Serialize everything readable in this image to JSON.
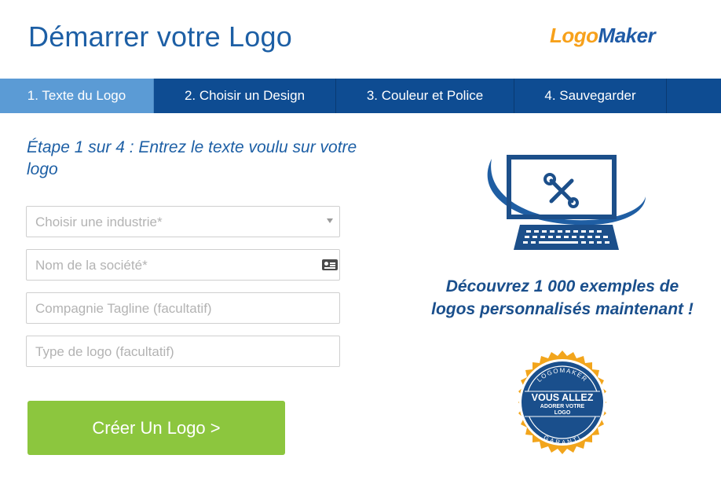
{
  "header": {
    "title": "Démarrer votre Logo",
    "brand_part1": "Logo",
    "brand_part2": "Maker"
  },
  "steps": [
    {
      "label": "1. Texte du Logo",
      "active": true
    },
    {
      "label": "2. Choisir un Design",
      "active": false
    },
    {
      "label": "3. Couleur et Police",
      "active": false
    },
    {
      "label": "4. Sauvegarder",
      "active": false
    }
  ],
  "form": {
    "instruction": "Étape 1 sur 4 : Entrez le texte voulu sur votre logo",
    "industry_placeholder": "Choisir une industrie*",
    "company_placeholder": "Nom de la société*",
    "tagline_placeholder": "Compagnie Tagline (facultatif)",
    "logo_type_placeholder": "Type de logo (facultatif)",
    "submit_label": "Créer Un Logo >"
  },
  "promo": {
    "text": "Découvrez 1 000 exemples de logos personnalisés maintenant !",
    "seal_top": "LOGOMAKER",
    "seal_main": "VOUS ALLEZ",
    "seal_line2": "ADORER VOTRE",
    "seal_line3": "LOGO",
    "seal_bottom": "GARANTI"
  },
  "colors": {
    "title_blue": "#1d5fa5",
    "nav_blue": "#0e4c92",
    "active_step": "#5b9bd5",
    "cta_green": "#8cc63e",
    "brand_orange": "#f7a11b",
    "seal_gold": "#f2a51c"
  },
  "icons": {
    "industry_dropdown": "chevron-down-icon",
    "company_field": "contact-card-icon",
    "illustration": "computer-tools-icon",
    "seal": "guarantee-seal-icon"
  }
}
